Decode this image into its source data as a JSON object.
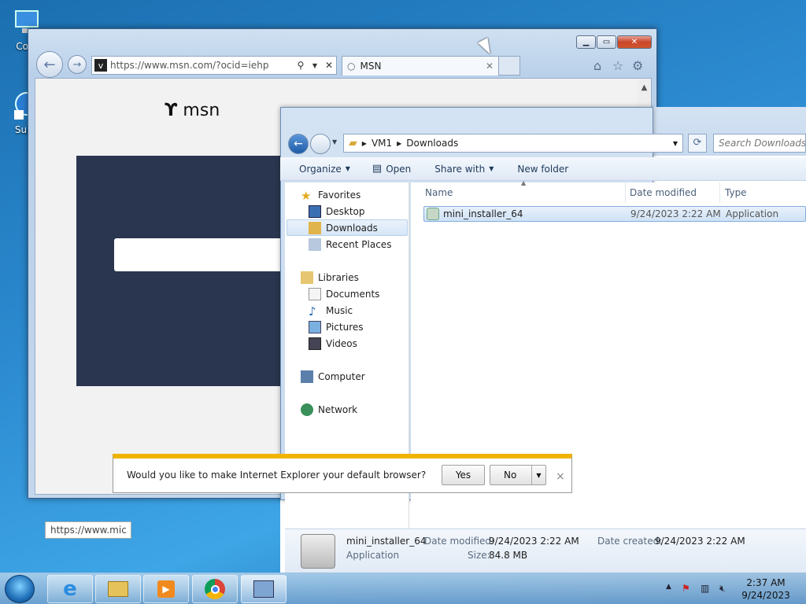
{
  "desktop": {
    "icons": [
      {
        "label": "Com",
        "icon": "computer-icon"
      },
      {
        "label": "Supe",
        "icon": "shortcut-icon"
      }
    ]
  },
  "ie": {
    "address": "https://www.msn.com/?ocid=iehp",
    "tab_title": "MSN",
    "msn_logo": "msn",
    "status_url": "https://www.mic"
  },
  "explorer": {
    "breadcrumb": [
      "VM1",
      "Downloads"
    ],
    "search_placeholder": "Search Downloads",
    "toolbar": {
      "organize": "Organize",
      "open": "Open",
      "share_with": "Share with",
      "new_folder": "New folder"
    },
    "nav": {
      "favorites": "Favorites",
      "desktop": "Desktop",
      "downloads": "Downloads",
      "recent_places": "Recent Places",
      "libraries": "Libraries",
      "documents": "Documents",
      "music": "Music",
      "pictures": "Pictures",
      "videos": "Videos",
      "computer": "Computer",
      "network": "Network"
    },
    "columns": {
      "name": "Name",
      "date_modified": "Date modified",
      "type": "Type"
    },
    "files": [
      {
        "name": "mini_installer_64",
        "date_modified": "9/24/2023 2:22 AM",
        "type": "Application"
      }
    ],
    "details": {
      "name": "mini_installer_64",
      "kind": "Application",
      "date_modified_label": "Date modified:",
      "date_modified": "9/24/2023 2:22 AM",
      "date_created_label": "Date created:",
      "date_created": "9/24/2023 2:22 AM",
      "size_label": "Size:",
      "size": "84.8 MB"
    }
  },
  "notification": {
    "message": "Would you like to make Internet Explorer your default browser?",
    "yes": "Yes",
    "no": "No",
    "close": "×"
  },
  "taskbar": {
    "time": "2:37 AM",
    "date": "9/24/2023"
  },
  "colors": {
    "accent": "#2c8ad0",
    "notif_bar": "#f0b400",
    "msn_panel": "#2a3650"
  }
}
